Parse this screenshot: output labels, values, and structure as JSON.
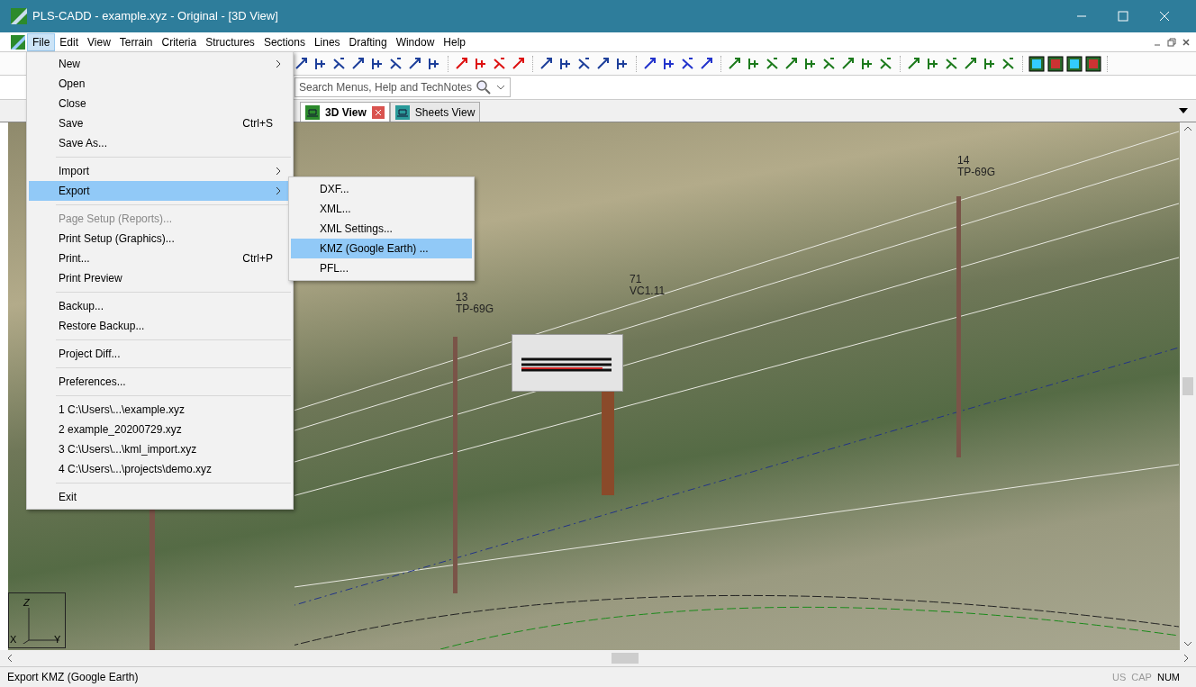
{
  "window": {
    "title": "PLS-CADD - example.xyz - Original - [3D View]"
  },
  "menu_bar": [
    {
      "label": "File",
      "selected": true
    },
    {
      "label": "Edit",
      "selected": false
    },
    {
      "label": "View",
      "selected": false
    },
    {
      "label": "Terrain",
      "selected": false
    },
    {
      "label": "Criteria",
      "selected": false
    },
    {
      "label": "Structures",
      "selected": false
    },
    {
      "label": "Sections",
      "selected": false
    },
    {
      "label": "Lines",
      "selected": false
    },
    {
      "label": "Drafting",
      "selected": false
    },
    {
      "label": "Window",
      "selected": false
    },
    {
      "label": "Help",
      "selected": false
    }
  ],
  "search": {
    "placeholder": "Search Menus, Help and TechNotes"
  },
  "tabs": [
    {
      "label": "3D View",
      "selected": true,
      "closable": true
    },
    {
      "label": "Sheets View",
      "selected": false,
      "closable": false
    }
  ],
  "file_menu": [
    {
      "kind": "item",
      "label": "New",
      "submenu": true,
      "disabled": false,
      "selected": false
    },
    {
      "kind": "item",
      "label": "Open",
      "disabled": false,
      "selected": false
    },
    {
      "kind": "item",
      "label": "Close",
      "disabled": false,
      "selected": false
    },
    {
      "kind": "item",
      "label": "Save",
      "shortcut": "Ctrl+S",
      "disabled": false,
      "selected": false
    },
    {
      "kind": "item",
      "label": "Save As...",
      "disabled": false,
      "selected": false
    },
    {
      "kind": "separator"
    },
    {
      "kind": "item",
      "label": "Import",
      "submenu": true,
      "disabled": false,
      "selected": false
    },
    {
      "kind": "item",
      "label": "Export",
      "submenu": true,
      "disabled": false,
      "selected": true
    },
    {
      "kind": "separator"
    },
    {
      "kind": "item",
      "label": "Page Setup (Reports)...",
      "disabled": true,
      "selected": false
    },
    {
      "kind": "item",
      "label": "Print Setup (Graphics)...",
      "disabled": false,
      "selected": false
    },
    {
      "kind": "item",
      "label": "Print...",
      "shortcut": "Ctrl+P",
      "disabled": false,
      "selected": false
    },
    {
      "kind": "item",
      "label": "Print Preview",
      "disabled": false,
      "selected": false
    },
    {
      "kind": "separator"
    },
    {
      "kind": "item",
      "label": "Backup...",
      "disabled": false,
      "selected": false
    },
    {
      "kind": "item",
      "label": "Restore Backup...",
      "disabled": false,
      "selected": false
    },
    {
      "kind": "separator"
    },
    {
      "kind": "item",
      "label": "Project Diff...",
      "disabled": false,
      "selected": false
    },
    {
      "kind": "separator"
    },
    {
      "kind": "item",
      "label": "Preferences...",
      "disabled": false,
      "selected": false
    },
    {
      "kind": "separator"
    },
    {
      "kind": "item",
      "label": "1 C:\\Users\\...\\example.xyz",
      "disabled": false,
      "selected": false
    },
    {
      "kind": "item",
      "label": "2 example_20200729.xyz",
      "disabled": false,
      "selected": false
    },
    {
      "kind": "item",
      "label": "3 C:\\Users\\...\\kml_import.xyz",
      "disabled": false,
      "selected": false
    },
    {
      "kind": "item",
      "label": "4 C:\\Users\\...\\projects\\demo.xyz",
      "disabled": false,
      "selected": false
    },
    {
      "kind": "separator"
    },
    {
      "kind": "item",
      "label": "Exit",
      "disabled": false,
      "selected": false
    }
  ],
  "export_submenu": [
    {
      "label": "DXF...",
      "selected": false
    },
    {
      "label": "XML...",
      "selected": false
    },
    {
      "label": "XML Settings...",
      "selected": false
    },
    {
      "label": "KMZ (Google Earth) ...",
      "selected": true
    },
    {
      "label": "PFL...",
      "selected": false
    }
  ],
  "scene": {
    "structure_labels": [
      {
        "number": "13",
        "type": "TP-69G"
      },
      {
        "number": "14",
        "type": "TP-69G"
      },
      {
        "number": "71",
        "type": "VC1.11"
      }
    ],
    "axes": [
      "Z",
      "X",
      "Y"
    ]
  },
  "status_bar": {
    "message": "Export KMZ (Google Earth)",
    "indicators": [
      {
        "label": "US",
        "on": false
      },
      {
        "label": "CAP",
        "on": false
      },
      {
        "label": "NUM",
        "on": true
      }
    ]
  }
}
